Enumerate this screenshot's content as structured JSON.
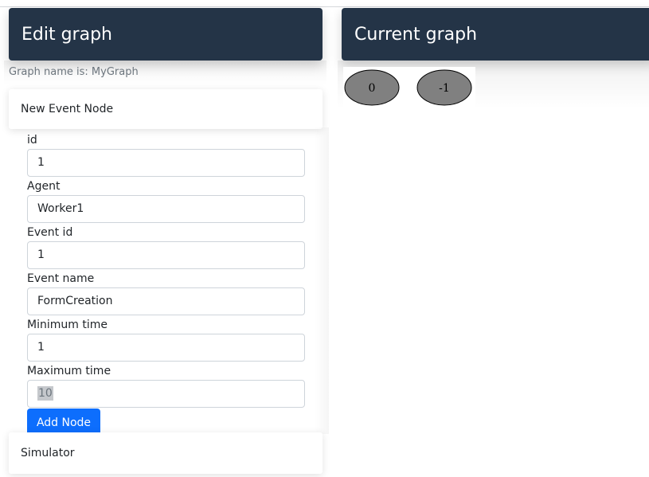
{
  "left_panel": {
    "title": "Edit graph",
    "graph_name_text": "Graph name is: MyGraph",
    "new_event_card": "New Event Node",
    "form": {
      "fields": [
        {
          "label": "id",
          "value": "1"
        },
        {
          "label": "Agent",
          "value": "Worker1"
        },
        {
          "label": "Event id",
          "value": "1"
        },
        {
          "label": "Event name",
          "value": "FormCreation"
        },
        {
          "label": "Minimum time",
          "value": "1"
        },
        {
          "label": "Maximum time",
          "value": "10"
        }
      ],
      "add_button": "Add Node"
    },
    "simulator_card": "Simulator"
  },
  "right_panel": {
    "title": "Current graph",
    "nodes": [
      {
        "label": "0"
      },
      {
        "label": "-1"
      }
    ]
  },
  "colors": {
    "header_bg": "#243447",
    "primary_button": "#0d6efd",
    "node_fill": "#808080"
  }
}
